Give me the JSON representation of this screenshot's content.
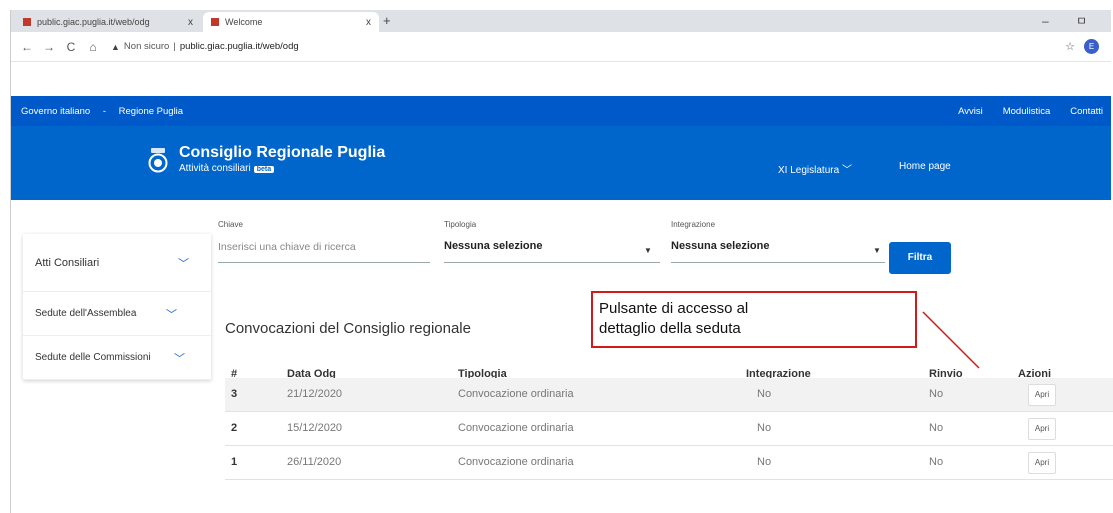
{
  "browser": {
    "tabs": [
      {
        "title": "public.giac.puglia.it/web/odg",
        "close": "x"
      },
      {
        "title": "Welcome",
        "close": "x"
      }
    ],
    "new_tab": "+",
    "window_controls": "– ㅁ",
    "nav_back": "←",
    "nav_forward": "→",
    "nav_reload": "C",
    "nav_home": "⌂",
    "security_label": "Non sicuro",
    "url": "public.giac.puglia.it/web/odg",
    "profile_initial": "E"
  },
  "slim_header": {
    "left": [
      "Governo italiano",
      "-",
      "Regione Puglia"
    ],
    "links": [
      "Avvisi",
      "Modulistica",
      "Contatti"
    ]
  },
  "center_header": {
    "title": "Consiglio Regionale Puglia",
    "subtitle": "Attività consiliari",
    "badge": "beta",
    "legislature": "XI Legislatura",
    "home": "Home page"
  },
  "sidebar": {
    "items": [
      {
        "label": "Atti Consiliari"
      },
      {
        "label": "Sedute dell'Assemblea"
      },
      {
        "label": "Sedute delle Commissioni"
      }
    ]
  },
  "filters": {
    "key_label": "Chiave",
    "key_placeholder": "Inserisci una chiave di ricerca",
    "type_label": "Tipologia",
    "type_value": "Nessuna selezione",
    "integration_label": "Integrazione",
    "integration_value": "Nessuna selezione",
    "submit": "Filtra"
  },
  "page_title": "Convocazioni del Consiglio regionale",
  "callout": {
    "line1": "Pulsante di accesso al",
    "line2": "dettaglio della seduta"
  },
  "table": {
    "headers": [
      "#",
      "Data Odg",
      "Tipologia",
      "Integrazione",
      "Rinvio",
      "Azioni"
    ],
    "rows": [
      {
        "num": "3",
        "date": "21/12/2020",
        "type": "Convocazione ordinaria",
        "integration": "No",
        "rinvio": "No",
        "action": "Apri"
      },
      {
        "num": "2",
        "date": "15/12/2020",
        "type": "Convocazione ordinaria",
        "integration": "No",
        "rinvio": "No",
        "action": "Apri"
      },
      {
        "num": "1",
        "date": "26/11/2020",
        "type": "Convocazione ordinaria",
        "integration": "No",
        "rinvio": "No",
        "action": "Apri"
      }
    ]
  },
  "colors": {
    "slim_bg": "#0059c9",
    "header_bg": "#0066cc",
    "callout_border": "#d21a1a"
  }
}
